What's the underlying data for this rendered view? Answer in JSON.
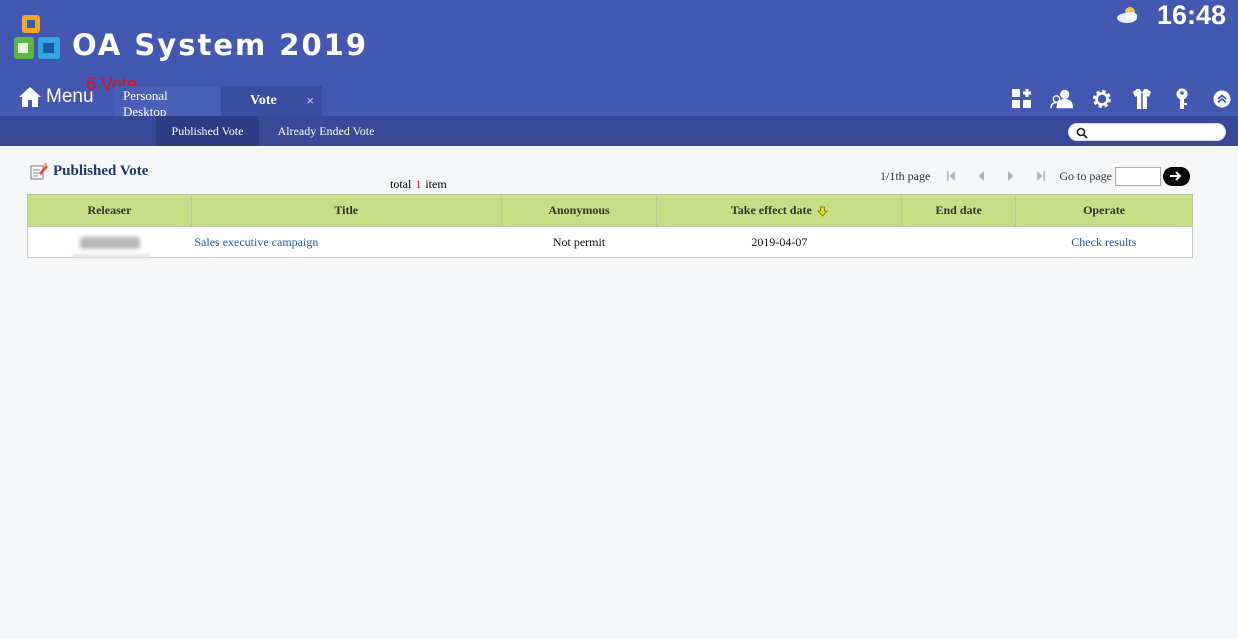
{
  "header": {
    "app_title": "OA System 2019",
    "clock": "16:48",
    "menu_label": "Menu",
    "annotation": "6.Vote",
    "accent_color": "#4358b0"
  },
  "tabs": [
    {
      "label": "Personal Desktop",
      "active": false
    },
    {
      "label": "Vote",
      "active": true,
      "close": "×"
    }
  ],
  "toolbar_icons": [
    "add-app-icon",
    "user-group-icon",
    "gear-icon",
    "shirt-icon",
    "key-icon",
    "collapse-up-icon"
  ],
  "subnav": {
    "items": [
      {
        "label": "Published Vote",
        "active": true
      },
      {
        "label": "Already Ended Vote",
        "active": false
      }
    ],
    "search_placeholder": ""
  },
  "section": {
    "title": "Published Vote"
  },
  "summary": {
    "prefix": "total",
    "count": "1",
    "suffix": "item"
  },
  "pager": {
    "page_info": "1/1th page",
    "goto_label": "Go to page"
  },
  "table": {
    "columns": [
      "Releaser",
      "Title",
      "Anonymous",
      "Take effect date",
      "End date",
      "Operate"
    ],
    "rows": [
      {
        "releaser": "",
        "title": "Sales executive campaign",
        "anonymous": "Not permit",
        "take_effect_date": "2019-04-07",
        "end_date": "",
        "operate": "Check results"
      }
    ]
  }
}
